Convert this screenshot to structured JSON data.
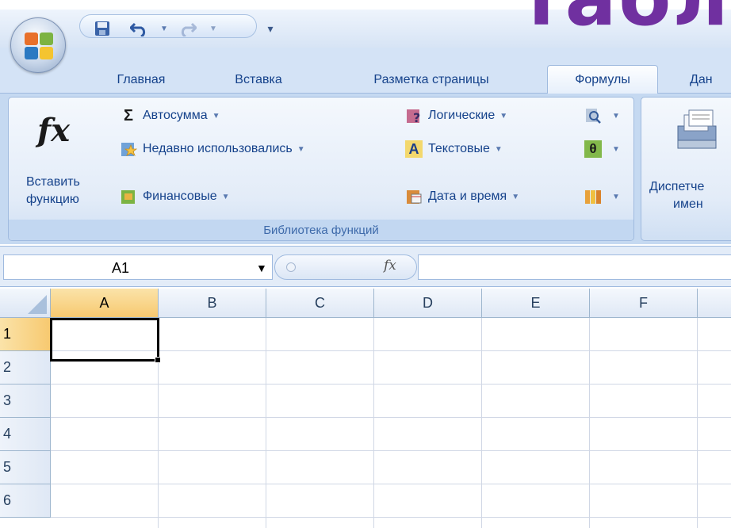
{
  "slide_title": "табл",
  "quick_access": {
    "save": "save-icon",
    "undo": "undo-icon",
    "redo": "redo-icon",
    "customize": "▾"
  },
  "tabs": [
    {
      "label": "Главная"
    },
    {
      "label": "Вставка"
    },
    {
      "label": "Разметка страницы"
    },
    {
      "label": "Формулы",
      "active": true
    },
    {
      "label": "Дан"
    }
  ],
  "ribbon": {
    "insert_function": {
      "line1": "Вставить",
      "line2": "функцию",
      "icon": "fx"
    },
    "library": {
      "label": "Библиотека функций",
      "autosum": "Автосумма",
      "recent": "Недавно использовались",
      "financial": "Финансовые",
      "logical": "Логические",
      "text": "Текстовые",
      "datetime": "Дата и время",
      "sigma": "Σ",
      "text_icon": "A",
      "theta": "θ"
    },
    "names": {
      "line1": "Диспетче",
      "line2": "имен"
    }
  },
  "formula_bar": {
    "name_box": "A1",
    "fx": "fx",
    "formula": ""
  },
  "grid": {
    "columns": [
      "A",
      "B",
      "C",
      "D",
      "E",
      "F"
    ],
    "rows": [
      "1",
      "2",
      "3",
      "4",
      "5",
      "6"
    ],
    "active_cell": "A1"
  },
  "colors": {
    "accent": "#15428b",
    "selected_header": "#f7c970",
    "title": "#7030a0"
  }
}
